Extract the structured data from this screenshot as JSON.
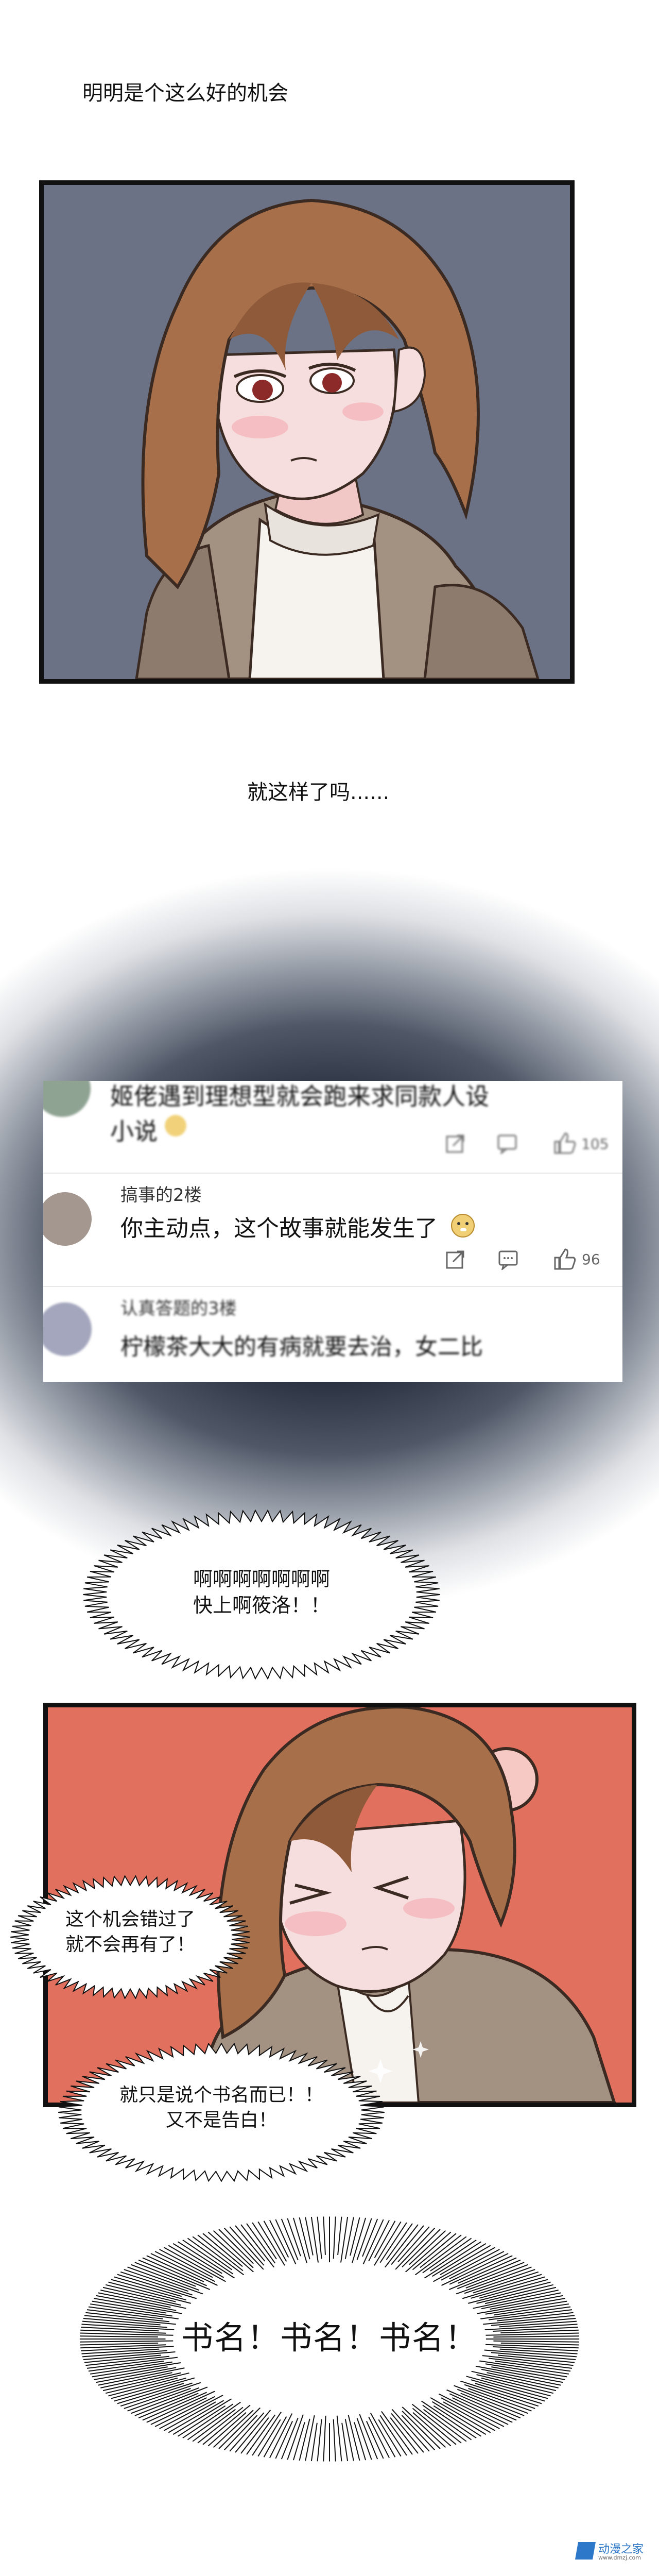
{
  "captions": {
    "line1": "明明是个这么好的机会",
    "line2": "就这样了吗......"
  },
  "comments": [
    {
      "username": "",
      "text_line1": "姬佬遇到理想型就会跑来求同款人设",
      "text_line2": "小说",
      "likes": "105",
      "emoji": "doge-emoji"
    },
    {
      "username": "搞事的2楼",
      "text": "你主动点，这个故事就能发生了",
      "likes": "96",
      "emoji": "doge-emoji"
    },
    {
      "username": "认真答题的3楼",
      "text": "柠檬茶大大的有病就要去治，女二比"
    }
  ],
  "bubbles": {
    "scream_line1": "啊啊啊啊啊啊啊",
    "scream_line2": "快上啊筱洛！！",
    "missed_line1": "这个机会错过了",
    "missed_line2": "就不会再有了！",
    "title_line1": "就只是说个书名而已！！",
    "title_line2": "又不是告白！",
    "shout": "书名！书名！书名！"
  },
  "watermark": {
    "brand": "动漫之家",
    "url": "www.dmzj.com"
  },
  "colors": {
    "panel1_bg": "#6b7285",
    "panel2_bg": "#e2705f",
    "hair": "#a8704a",
    "coat": "#a39182",
    "fog": "#2a3242"
  }
}
